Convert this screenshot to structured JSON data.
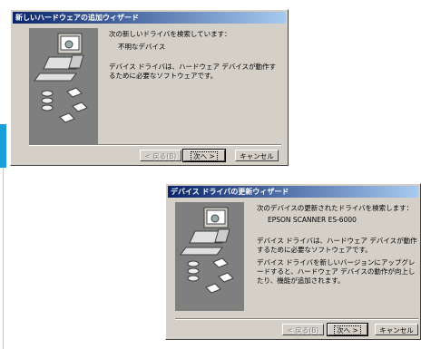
{
  "dialog1": {
    "title": "新しいハードウェアの追加ウィザード",
    "line1": "次の新しいドライバを検索しています：",
    "device": "不明なデバイス",
    "line2": "デバイス ドライバは、ハードウェア デバイスが動作するために必要なソフトウェアです。",
    "back_label": "< 戻る(B)",
    "next_label": "次へ >",
    "cancel_label": "キャンセル"
  },
  "dialog2": {
    "title": "デバイス ドライバの更新ウィザード",
    "line1": "次のデバイスの更新されたドライバを検索します：",
    "device": "EPSON SCANNER ES-6000",
    "line2": "デバイス ドライバは、ハードウェア デバイスが動作するために必要なソフトウェアです。",
    "line3": "デバイス ドライバを新しいバージョンにアップグレードすると、ハードウェア デバイスの動作が向上したり、機能が追加されます。",
    "back_label": "< 戻る(B)",
    "next_label": "次へ >",
    "cancel_label": "キャンセル"
  },
  "colors": {
    "accent_bar": "#1aa0d6",
    "dialog_bg": "#d4d0c8",
    "image_bg": "#7f7f7f",
    "titlebar": "#0a246a"
  }
}
